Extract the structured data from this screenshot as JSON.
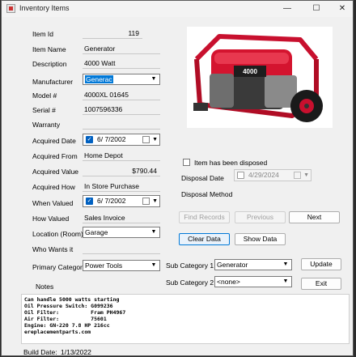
{
  "window": {
    "title": "Inventory Items",
    "minimize": "—",
    "maximize": "☐",
    "close": "✕"
  },
  "labels": {
    "item_id": "Item Id",
    "item_name": "Item Name",
    "description": "Description",
    "manufacturer": "Manufacturer",
    "model": "Model #",
    "serial": "Serial #",
    "warranty": "Warranty",
    "acquired_date": "Acquired Date",
    "acquired_from": "Acquired From",
    "acquired_value": "Acquired Value",
    "acquired_how": "Acquired How",
    "when_valued": "When Valued",
    "how_valued": "How Valued",
    "location": "Location (Room)",
    "who_wants": "Who Wants it",
    "primary_category": "Primary Category",
    "notes": "Notes",
    "disposed": "Item has been disposed",
    "disposal_date": "Disposal Date",
    "disposal_method": "Disposal Method",
    "sub_category_1": "Sub Category 1",
    "sub_category_2": "Sub Category 2",
    "build_date": "Build Date:"
  },
  "values": {
    "item_id": "119",
    "item_name": "Generator",
    "description": "4000 Watt",
    "manufacturer": "Generac",
    "model": "4000XL 01645",
    "serial": "1007596336",
    "warranty": "",
    "acquired_date": "6/  7/2002",
    "acquired_from": "Home Depot",
    "acquired_value": "$790.44",
    "acquired_how": "In Store Purchase",
    "when_valued": "6/  7/2002",
    "how_valued": "Sales Invoice",
    "location": "Garage",
    "who_wants": "",
    "primary_category": "Power Tools",
    "disposal_date": "4/29/2024",
    "disposal_method": "",
    "sub_category_1": "Generator",
    "sub_category_2": "<none>",
    "build_date": "1/13/2022"
  },
  "buttons": {
    "find_records": "Find Records",
    "previous": "Previous",
    "next": "Next",
    "clear_data": "Clear Data",
    "show_data": "Show Data",
    "update": "Update",
    "exit": "Exit"
  },
  "photo": {
    "brand_text": "4000",
    "icon": "generator-photo"
  },
  "notes_lines": [
    "Can handle 5000 watts starting",
    "Oil Pressure Switch: G099236",
    "Oil Filter:          Fram PH4967",
    "Air Filter:          75601",
    "Engine: GN-220 7.8 HP 216cc",
    "ereplacementparts.com"
  ],
  "colors": {
    "accent": "#0078d7",
    "generator_red": "#c8102e"
  }
}
